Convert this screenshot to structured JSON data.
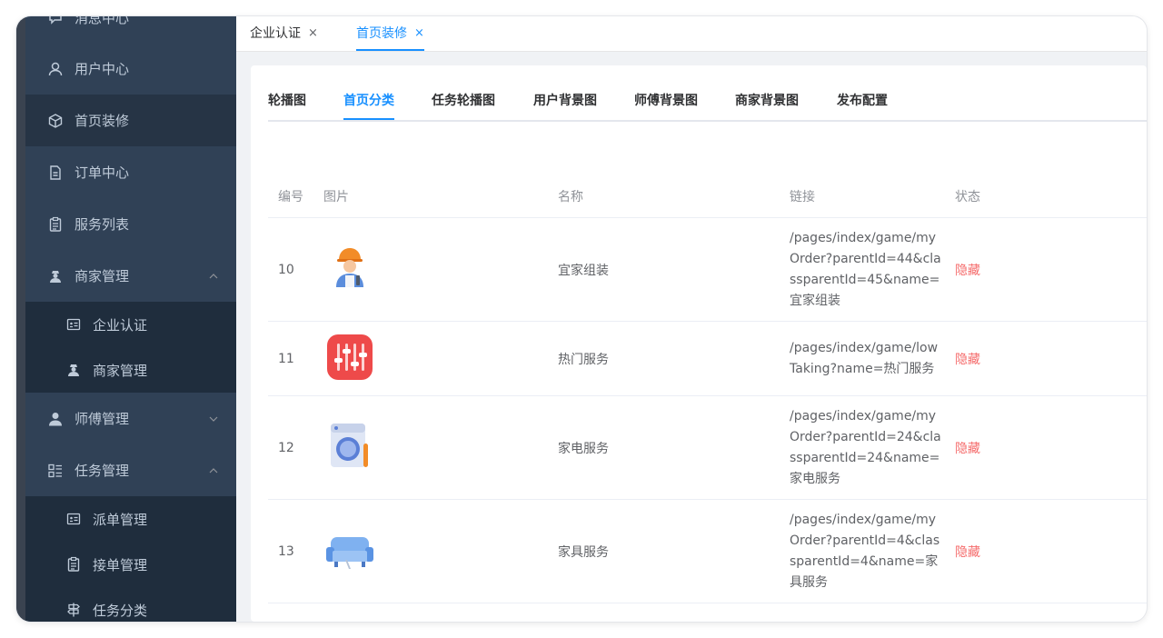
{
  "sidebar": {
    "items": [
      {
        "label": "消息中心",
        "icon": "chat-icon"
      },
      {
        "label": "用户中心",
        "icon": "user-icon"
      },
      {
        "label": "首页装修",
        "icon": "cube-icon"
      },
      {
        "label": "订单中心",
        "icon": "document-icon"
      },
      {
        "label": "服务列表",
        "icon": "clipboard-icon"
      },
      {
        "label": "商家管理",
        "icon": "merchant-icon"
      },
      {
        "label": "企业认证",
        "icon": "id-card-icon"
      },
      {
        "label": "商家管理",
        "icon": "merchant-icon"
      },
      {
        "label": "师傅管理",
        "icon": "person-icon"
      },
      {
        "label": "任务管理",
        "icon": "list-icon"
      },
      {
        "label": "派单管理",
        "icon": "id-card-icon"
      },
      {
        "label": "接单管理",
        "icon": "clipboard-icon"
      },
      {
        "label": "任务分类",
        "icon": "signpost-icon"
      }
    ]
  },
  "tabs": [
    {
      "label": "企业认证",
      "close": "×"
    },
    {
      "label": "首页装修",
      "close": "×"
    }
  ],
  "subtabs": [
    "轮播图",
    "首页分类",
    "任务轮播图",
    "用户背景图",
    "师傅背景图",
    "商家背景图",
    "发布配置"
  ],
  "table": {
    "headers": {
      "id": "编号",
      "image": "图片",
      "name": "名称",
      "link": "链接",
      "status": "状态"
    },
    "rows": [
      {
        "id": "10",
        "name": "宜家组装",
        "link": "/pages/index/game/myOrder?parentId=44&classparentId=45&name=宜家组装",
        "status": "隐藏",
        "image": "worker-icon"
      },
      {
        "id": "11",
        "name": "热门服务",
        "link": "/pages/index/game/lowTaking?name=热门服务",
        "status": "隐藏",
        "image": "sliders-icon"
      },
      {
        "id": "12",
        "name": "家电服务",
        "link": "/pages/index/game/myOrder?parentId=24&classparentId=24&name=家电服务",
        "status": "隐藏",
        "image": "washing-machine-icon"
      },
      {
        "id": "13",
        "name": "家具服务",
        "link": "/pages/index/game/myOrder?parentId=4&classparentId=4&name=家具服务",
        "status": "隐藏",
        "image": "sofa-icon"
      }
    ]
  },
  "colors": {
    "accent": "#1890ff",
    "status_hidden": "#f56c6c",
    "sidebar_bg": "#304156"
  }
}
